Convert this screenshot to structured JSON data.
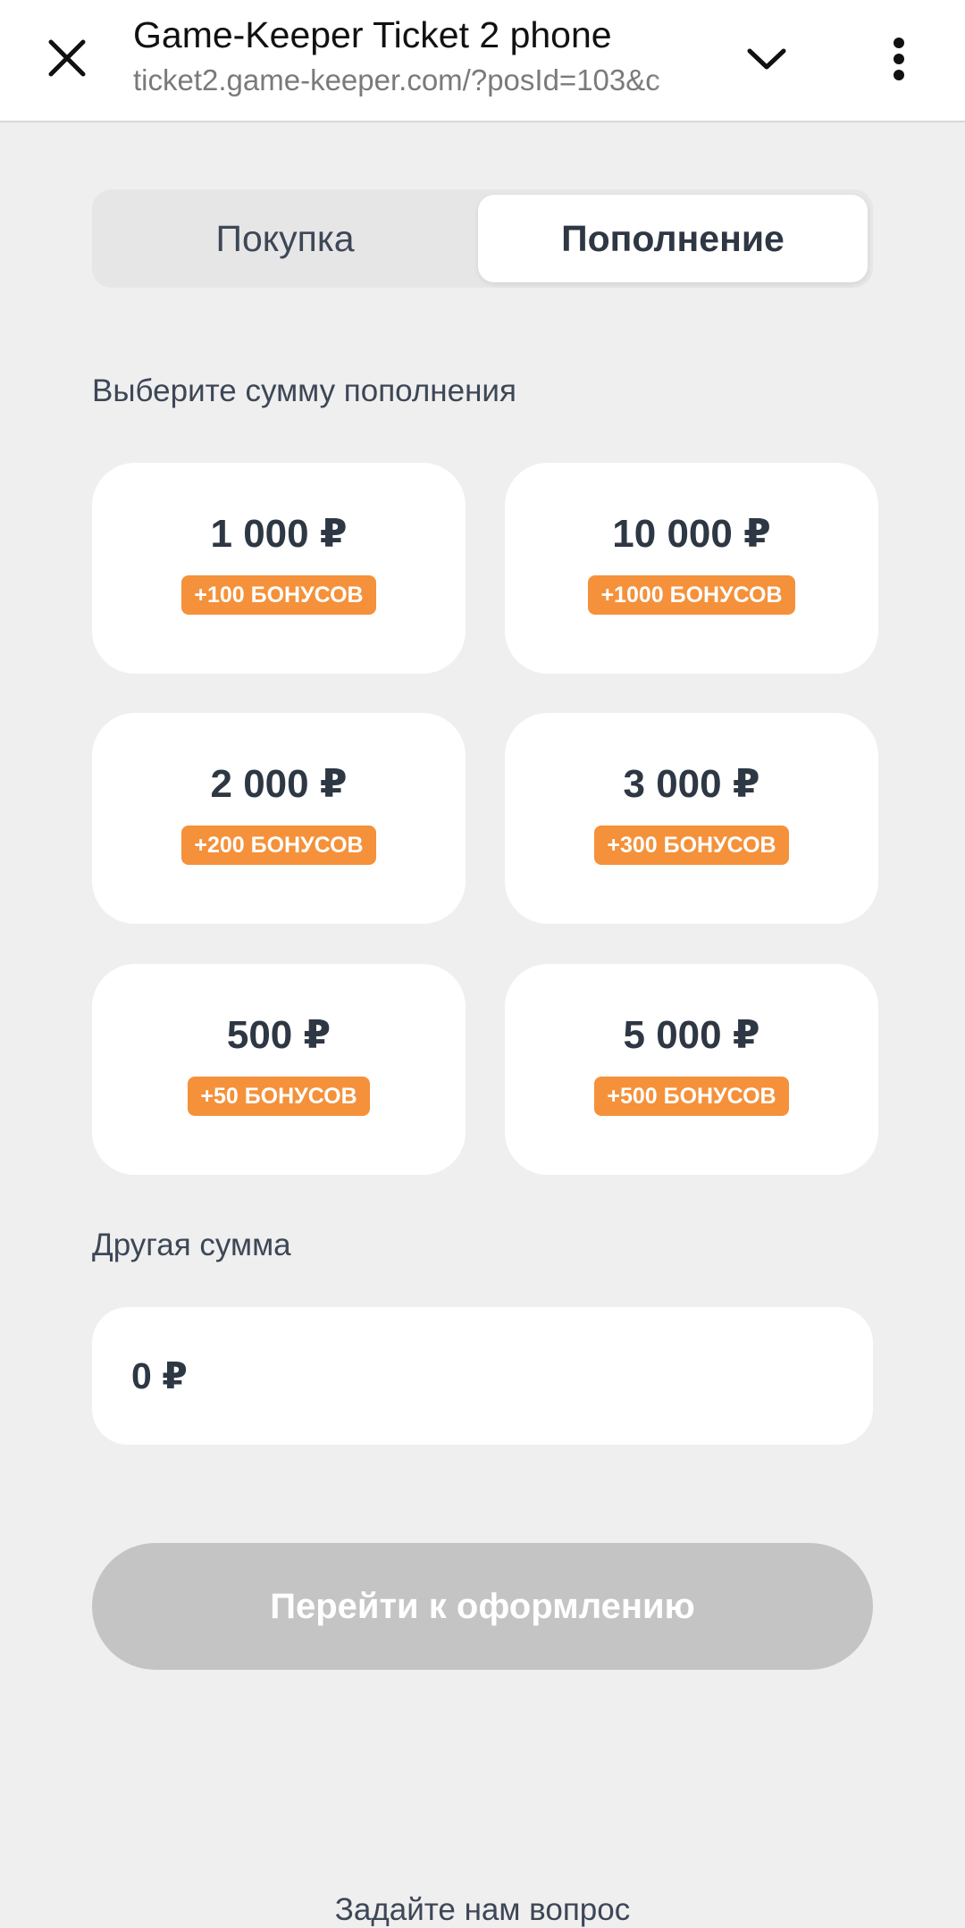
{
  "browser": {
    "title": "Game-Keeper Ticket 2 phone",
    "url": "ticket2.game-keeper.com/?posId=103&c"
  },
  "tabs": [
    {
      "label": "Покупка",
      "selected": false
    },
    {
      "label": "Пополнение",
      "selected": true
    }
  ],
  "amount_section": {
    "label": "Выберите сумму пополнения",
    "options": [
      {
        "amount": "1 000 ₽",
        "bonus": "+100 БОНУСОВ"
      },
      {
        "amount": "10 000 ₽",
        "bonus": "+1000 БОНУСОВ"
      },
      {
        "amount": "2 000 ₽",
        "bonus": "+200 БОНУСОВ"
      },
      {
        "amount": "3 000 ₽",
        "bonus": "+300 БОНУСОВ"
      },
      {
        "amount": "500 ₽",
        "bonus": "+50 БОНУСОВ"
      },
      {
        "amount": "5 000 ₽",
        "bonus": "+500 БОНУСОВ"
      }
    ]
  },
  "other_amount": {
    "label": "Другая сумма",
    "value": "0 ₽"
  },
  "checkout": {
    "label": "Перейти к оформлению",
    "enabled": false
  },
  "footer": {
    "ask_label": "Задайте нам вопрос"
  },
  "colors": {
    "accent_orange": "#f4913a",
    "text_dark": "#2e3744",
    "background": "#efefef",
    "button_disabled": "#c4c4c4"
  },
  "icons": [
    "close-icon",
    "chevron-down-icon",
    "more-vertical-icon"
  ]
}
